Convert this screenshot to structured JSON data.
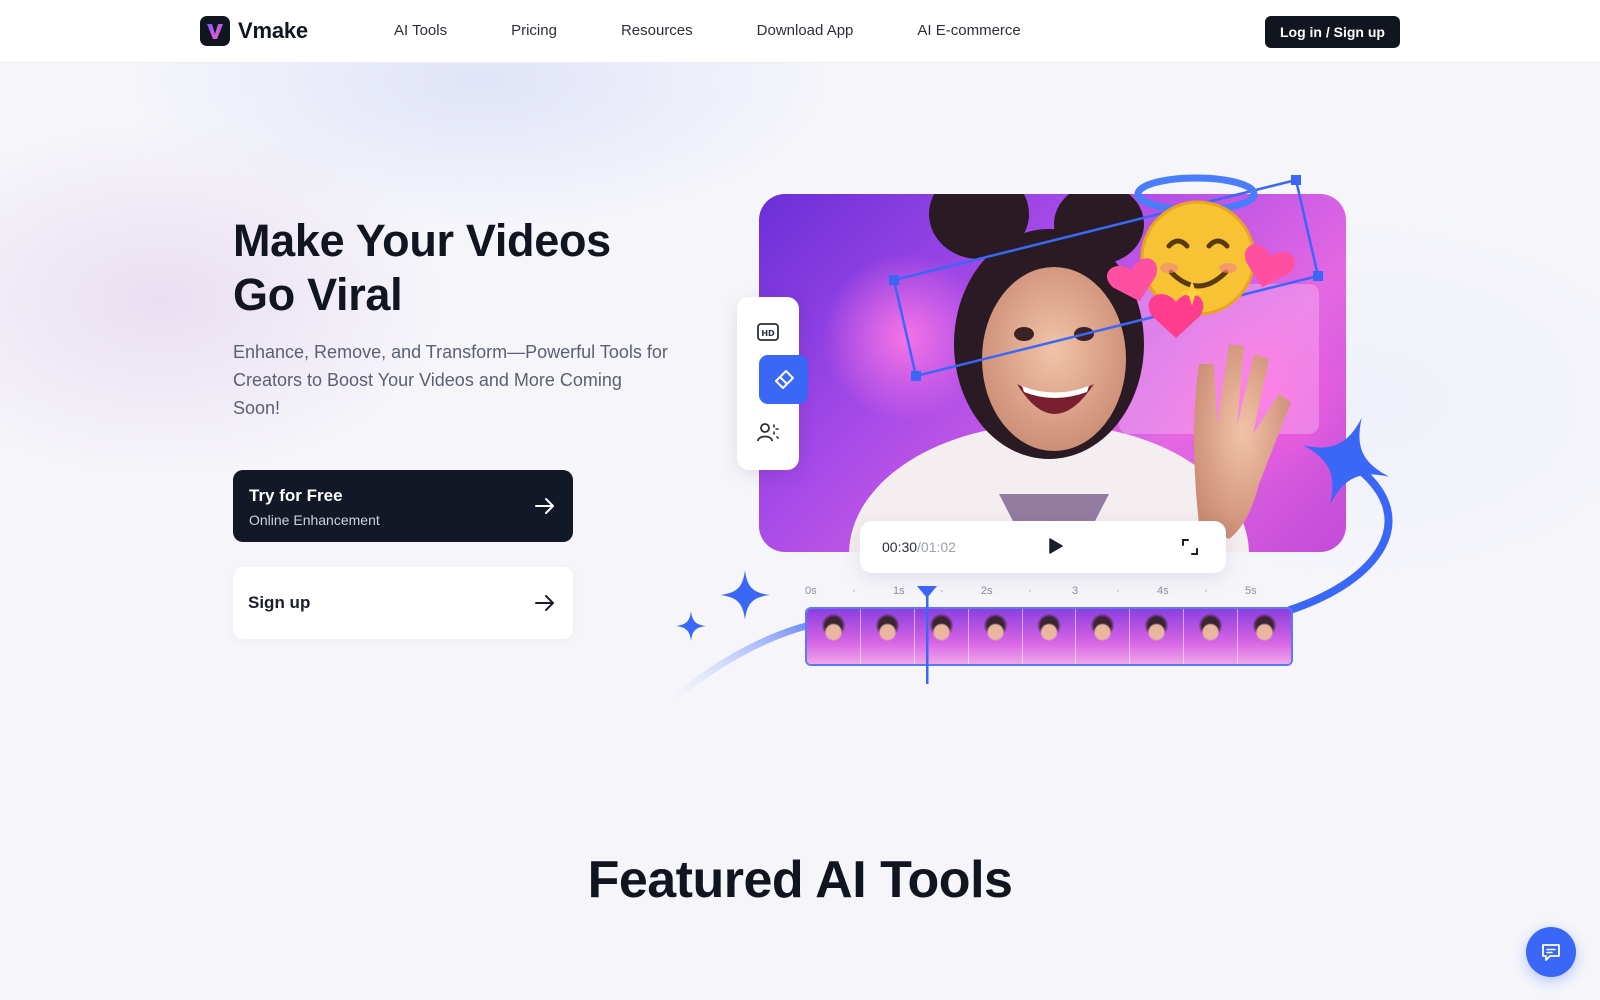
{
  "brand": {
    "name": "Vmake",
    "logo_letter": "V",
    "accent": "#3a67f5",
    "dark": "#131826"
  },
  "nav": {
    "links": [
      "AI Tools",
      "Pricing",
      "Resources",
      "Download App",
      "AI E-commerce"
    ],
    "login_label": "Log in / Sign up"
  },
  "hero": {
    "title_line1": "Make Your Videos",
    "title_line2": "Go Viral",
    "subtitle": "Enhance, Remove, and Transform—Powerful Tools for Creators to Boost Your Videos and More Coming Soon!",
    "cta_primary": {
      "title": "Try for Free",
      "subtitle": "Online Enhancement",
      "icon": "arrow-right-icon"
    },
    "cta_secondary": {
      "title": "Sign up",
      "icon": "arrow-right-icon"
    }
  },
  "editor": {
    "tools": [
      {
        "icon": "hd-icon",
        "active": false
      },
      {
        "icon": "eraser-icon",
        "active": true
      },
      {
        "icon": "person-remove-icon",
        "active": false
      }
    ],
    "player": {
      "current_time": "00:30",
      "total_time": "/01:02",
      "play_icon": "play-icon",
      "fullscreen_icon": "fullscreen-icon"
    },
    "timeline_ticks": [
      "0s",
      "·",
      "1s",
      "·",
      "2s",
      "·",
      "3",
      "·",
      "4s",
      "·",
      "5s"
    ],
    "frames": 9,
    "emoji": "angel-smile-emoji"
  },
  "featured": {
    "title": "Featured AI Tools"
  },
  "chat": {
    "icon": "chat-icon"
  }
}
